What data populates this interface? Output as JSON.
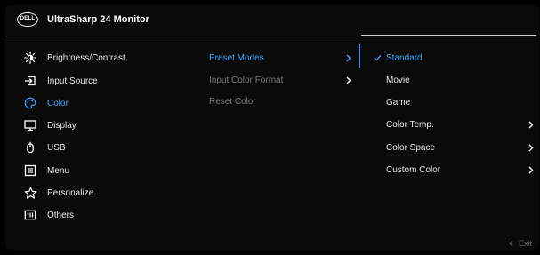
{
  "header": {
    "logo_text": "DELL",
    "model": "UltraSharp 24 Monitor"
  },
  "menu": {
    "items": [
      {
        "label": "Brightness/Contrast",
        "icon": "brightness-icon"
      },
      {
        "label": "Input Source",
        "icon": "input-source-icon"
      },
      {
        "label": "Color",
        "icon": "color-palette-icon"
      },
      {
        "label": "Display",
        "icon": "display-icon"
      },
      {
        "label": "USB",
        "icon": "usb-icon"
      },
      {
        "label": "Menu",
        "icon": "menu-icon"
      },
      {
        "label": "Personalize",
        "icon": "star-icon"
      },
      {
        "label": "Others",
        "icon": "others-icon"
      }
    ],
    "active_index": 2
  },
  "submenu": {
    "items": [
      {
        "label": "Preset Modes",
        "state": "active",
        "has_arrow": true
      },
      {
        "label": "Input Color Format",
        "state": "disabled",
        "has_arrow": true
      },
      {
        "label": "Reset Color",
        "state": "disabled",
        "has_arrow": false
      }
    ]
  },
  "options": {
    "items": [
      {
        "label": "Standard",
        "selected": true,
        "has_arrow": false
      },
      {
        "label": "Movie",
        "selected": false,
        "has_arrow": false
      },
      {
        "label": "Game",
        "selected": false,
        "has_arrow": false
      },
      {
        "label": "Color Temp.",
        "selected": false,
        "has_arrow": true
      },
      {
        "label": "Color Space",
        "selected": false,
        "has_arrow": true
      },
      {
        "label": "Custom Color",
        "selected": false,
        "has_arrow": true
      }
    ]
  },
  "footer": {
    "exit_label": "Exit"
  },
  "colors": {
    "accent": "#3aa7ff",
    "background": "#0a0a0a",
    "disabled": "#7a7a7a"
  }
}
